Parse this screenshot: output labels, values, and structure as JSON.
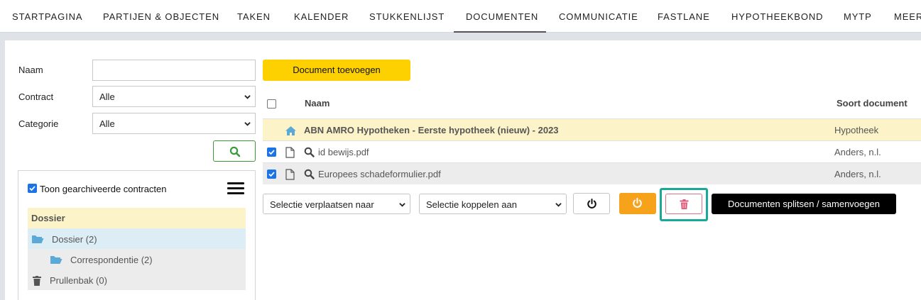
{
  "nav": {
    "items": [
      "STARTPAGINA",
      "PARTIJEN & OBJECTEN",
      "TAKEN",
      "KALENDER",
      "STUKKENLIJST",
      "DOCUMENTEN",
      "COMMUNICATIE",
      "FASTLANE",
      "HYPOTHEEKBOND",
      "MYTP",
      "MEER"
    ],
    "active": "DOCUMENTEN"
  },
  "filters": {
    "naam_label": "Naam",
    "naam_value": "",
    "contract_label": "Contract",
    "contract_value": "Alle",
    "categorie_label": "Categorie",
    "categorie_value": "Alle",
    "search_icon": "search-icon"
  },
  "tree": {
    "show_archived_checked": true,
    "show_archived_label": "Toon gearchiveerde contracten",
    "menu_icon": "hamburger-menu-icon",
    "header": "Dossier",
    "nodes": [
      {
        "label": "Dossier (2)",
        "icon": "folder-open-icon",
        "selected": true
      },
      {
        "label": "Correspondentie (2)",
        "icon": "folder-open-icon",
        "selected": false
      },
      {
        "label": "Prullenbak (0)",
        "icon": "trash-icon",
        "selected": false
      }
    ]
  },
  "documents": {
    "add_button": "Document toevoegen",
    "columns": {
      "name": "Naam",
      "type": "Soort document"
    },
    "rows": [
      {
        "name": "ABN AMRO Hypotheken - Eerste hypotheek (nieuw) - 2023",
        "type": "Hypotheek",
        "icon": "home-icon",
        "checked": null,
        "highlight": "#fcf4c8"
      },
      {
        "name": "id bewijs.pdf",
        "type": "Anders, n.l.",
        "icon": "file-icon",
        "checked": true,
        "highlight": "#ffffff"
      },
      {
        "name": "Europees schadeformulier.pdf",
        "type": "Anders, n.l.",
        "icon": "file-icon",
        "checked": true,
        "highlight": "#ececec"
      }
    ]
  },
  "actions": {
    "move_select": "Selectie verplaatsen naar",
    "link_select": "Selectie koppelen aan",
    "power_icon": "power-icon",
    "delete_icon": "trash-icon",
    "split_button": "Documenten splitsen / samenvoegen"
  },
  "colors": {
    "accent_yellow": "#fdd000",
    "orange": "#f7a21b",
    "highlight_frame": "#19a99a",
    "checkbox_blue": "#1a73e8",
    "folder_blue": "#5aa9d6"
  }
}
